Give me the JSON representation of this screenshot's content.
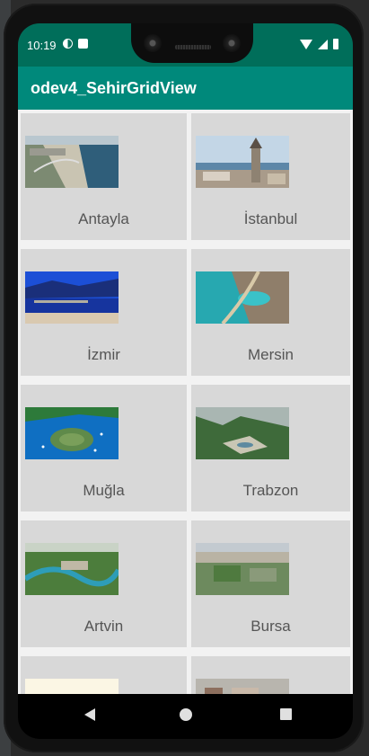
{
  "status_bar": {
    "time": "10:19",
    "icons": [
      "circle-half-icon",
      "sd-card-icon",
      "wifi-icon",
      "signal-icon",
      "battery-icon"
    ]
  },
  "app_bar": {
    "title": "odev4_SehirGridView",
    "color": "#00897b"
  },
  "cities": [
    {
      "name": "Antayla",
      "image": "antalya-coast-icon"
    },
    {
      "name": "İstanbul",
      "image": "istanbul-galata-icon"
    },
    {
      "name": "İzmir",
      "image": "izmir-bay-icon"
    },
    {
      "name": "Mersin",
      "image": "mersin-coast-icon"
    },
    {
      "name": "Muğla",
      "image": "mugla-island-icon"
    },
    {
      "name": "Trabzon",
      "image": "trabzon-valley-icon"
    },
    {
      "name": "Artvin",
      "image": "artvin-river-icon"
    },
    {
      "name": "Bursa",
      "image": "bursa-city-icon"
    },
    {
      "name": "",
      "image": "partial-thumbnail-icon"
    },
    {
      "name": "",
      "image": "partial-thumbnail-icon"
    }
  ],
  "nav_bar": {
    "buttons": [
      "back-icon",
      "home-icon",
      "recents-icon"
    ]
  }
}
